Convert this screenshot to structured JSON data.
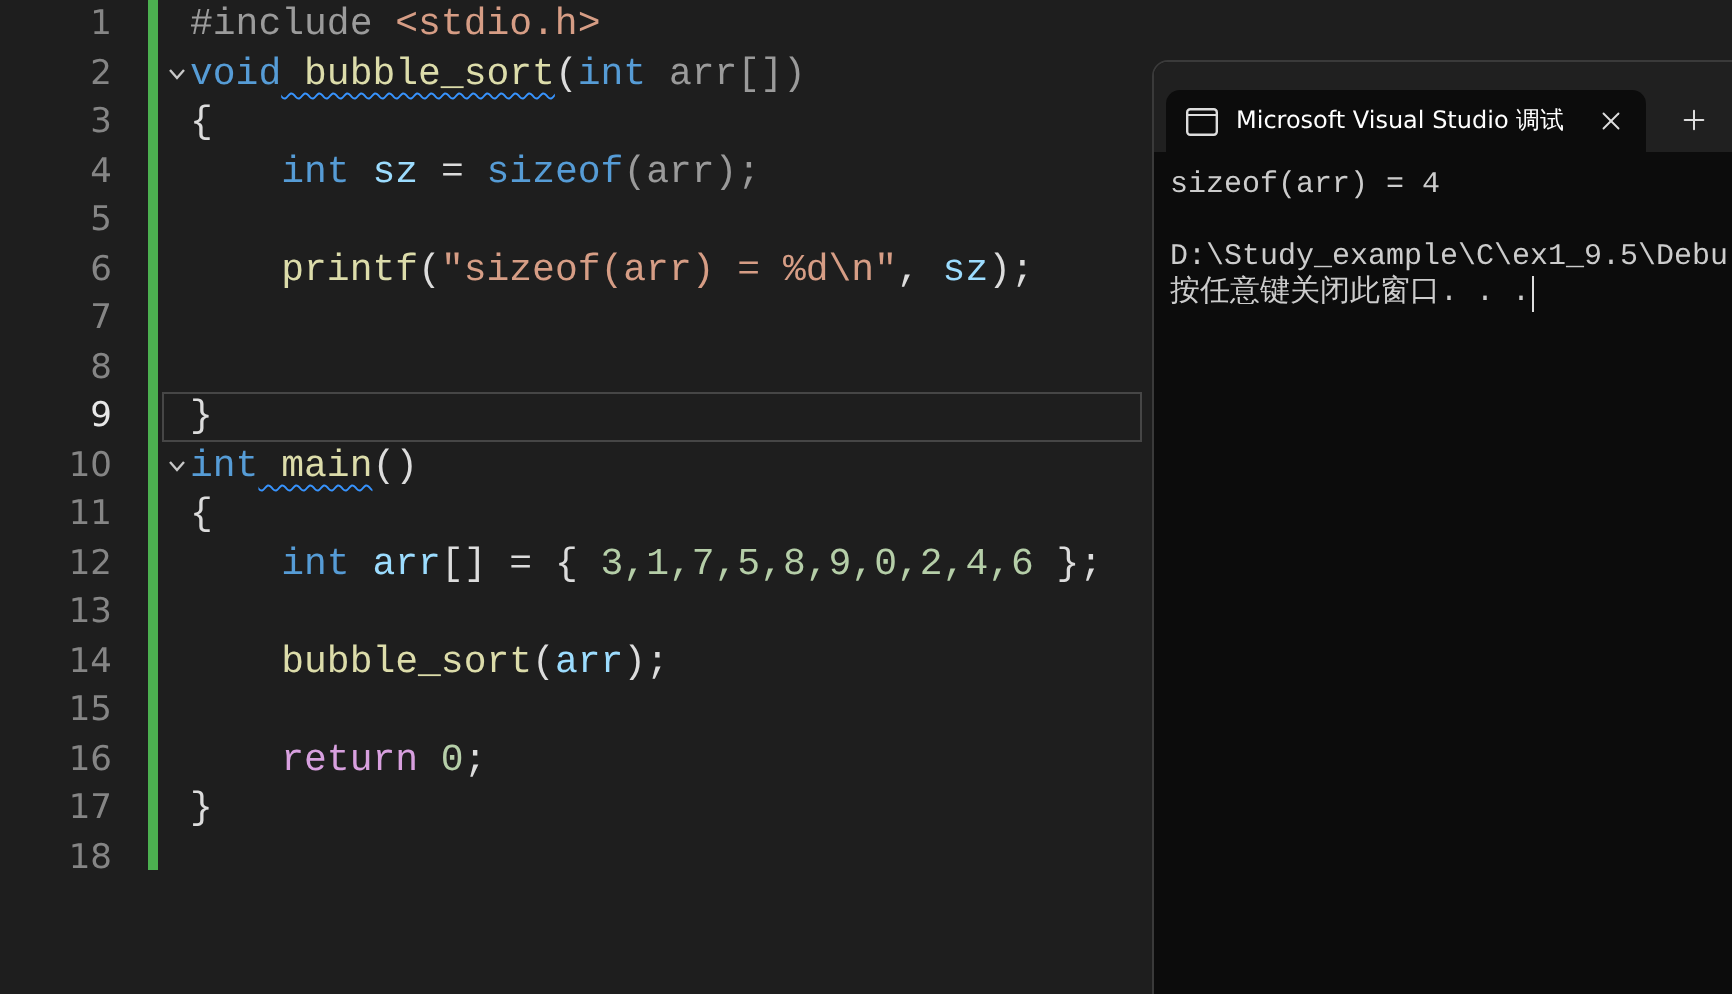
{
  "editor": {
    "lines": [
      {
        "number": "1",
        "tokens": [
          {
            "text": "#include",
            "kind": "preproc"
          },
          {
            "text": " <stdio.h>",
            "kind": "string"
          }
        ]
      },
      {
        "number": "2",
        "fold": true,
        "tokens": [
          {
            "text": "void",
            "kind": "keyword"
          },
          {
            "text": " bubble_sort",
            "kind": "function",
            "squiggle": true
          },
          {
            "text": "(",
            "kind": "plain"
          },
          {
            "text": "int",
            "kind": "keyword"
          },
          {
            "text": " arr[])",
            "kind": "param"
          }
        ]
      },
      {
        "number": "3",
        "tokens": [
          {
            "text": "{",
            "kind": "plain"
          }
        ]
      },
      {
        "number": "4",
        "tokens": [
          {
            "text": "    int",
            "kind": "keyword"
          },
          {
            "text": " sz",
            "kind": "local"
          },
          {
            "text": " =",
            "kind": "plain"
          },
          {
            "text": " sizeof",
            "kind": "keyword"
          },
          {
            "text": "(arr);",
            "kind": "param"
          }
        ]
      },
      {
        "number": "5"
      },
      {
        "number": "6",
        "tokens": [
          {
            "text": "    printf",
            "kind": "function"
          },
          {
            "text": "(",
            "kind": "plain"
          },
          {
            "text": "\"sizeof(arr) = %d\\n\"",
            "kind": "string"
          },
          {
            "text": ",",
            "kind": "plain"
          },
          {
            "text": " sz",
            "kind": "local"
          },
          {
            "text": ");",
            "kind": "plain"
          }
        ]
      },
      {
        "number": "7"
      },
      {
        "number": "8"
      },
      {
        "number": "9",
        "current": true,
        "tokens": [
          {
            "text": "}",
            "kind": "plain"
          }
        ]
      },
      {
        "number": "10",
        "fold": true,
        "tokens": [
          {
            "text": "int",
            "kind": "keyword"
          },
          {
            "text": " main",
            "kind": "function",
            "squiggle": true
          },
          {
            "text": "()",
            "kind": "plain"
          }
        ]
      },
      {
        "number": "11",
        "tokens": [
          {
            "text": "{",
            "kind": "plain"
          }
        ]
      },
      {
        "number": "12",
        "tokens": [
          {
            "text": "    int",
            "kind": "keyword"
          },
          {
            "text": " arr",
            "kind": "local"
          },
          {
            "text": "[] = {",
            "kind": "plain"
          },
          {
            "text": " 3,1,7,5,8,9,0,2,4,6",
            "kind": "number"
          },
          {
            "text": " };",
            "kind": "plain"
          }
        ]
      },
      {
        "number": "13"
      },
      {
        "number": "14",
        "tokens": [
          {
            "text": "    bubble_sort",
            "kind": "function"
          },
          {
            "text": "(",
            "kind": "plain"
          },
          {
            "text": "arr",
            "kind": "local"
          },
          {
            "text": ");",
            "kind": "plain"
          }
        ]
      },
      {
        "number": "15"
      },
      {
        "number": "16",
        "tokens": [
          {
            "text": "    return",
            "kind": "control"
          },
          {
            "text": " 0",
            "kind": "number"
          },
          {
            "text": ";",
            "kind": "plain"
          }
        ]
      },
      {
        "number": "17",
        "tokens": [
          {
            "text": "}",
            "kind": "plain"
          }
        ]
      },
      {
        "number": "18"
      }
    ]
  },
  "console": {
    "tab_title": "Microsoft Visual Studio 调试",
    "output_blocks": [
      {
        "lines": [
          "sizeof(arr) = 4"
        ]
      },
      {
        "lines": [
          "D:\\Study_example\\C\\ex1_9.5\\Debu",
          "按任意键关闭此窗口. . ."
        ]
      }
    ]
  }
}
